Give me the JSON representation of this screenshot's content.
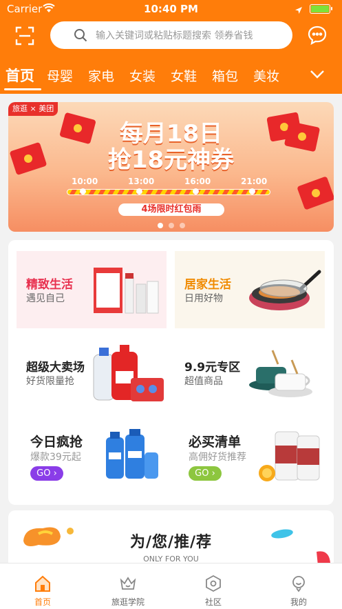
{
  "status_bar": {
    "carrier": "Carrier",
    "time": "10:40 PM"
  },
  "search": {
    "placeholder": "输入关键词或粘贴标题搜索 领券省钱"
  },
  "tabs": [
    {
      "label": "首页",
      "active": true
    },
    {
      "label": "母婴"
    },
    {
      "label": "家电"
    },
    {
      "label": "女装"
    },
    {
      "label": "女鞋"
    },
    {
      "label": "箱包"
    },
    {
      "label": "美妆"
    }
  ],
  "banner": {
    "tag": "旅逛 × 美团",
    "title_line1": "每月18日",
    "title_line2": "抢18元神券",
    "times": [
      "10:00",
      "13:00",
      "16:00",
      "21:00"
    ],
    "pill": "4场限时红包雨",
    "pages": 3,
    "current_page": 1
  },
  "tiles": [
    {
      "title": "精致生活",
      "subtitle": "遇见自己",
      "title_color": "#e8314f",
      "bg": "#fdeef0"
    },
    {
      "title": "居家生活",
      "subtitle": "日用好物",
      "title_color": "#f08a00",
      "bg": "#fbf6ec"
    },
    {
      "title": "超级大卖场",
      "subtitle": "好货限量抢"
    },
    {
      "title": "9.9元专区",
      "subtitle": "超值商品"
    },
    {
      "title": "今日疯抢",
      "subtitle": "爆款39元起",
      "button": "GO",
      "button_color": "#8a3de8"
    },
    {
      "title": "必买清单",
      "subtitle": "高佣好货推荐",
      "button": "GO",
      "button_color": "#8dc63f"
    }
  ],
  "recommend": {
    "title": "为/您/推/荐",
    "subtitle": "ONLY FOR YOU"
  },
  "tabbar": [
    {
      "label": "首页",
      "icon": "home-icon",
      "active": true
    },
    {
      "label": "旅逛学院",
      "icon": "academy-icon"
    },
    {
      "label": "社区",
      "icon": "community-icon"
    },
    {
      "label": "我的",
      "icon": "profile-icon"
    }
  ],
  "colors": {
    "brand": "#ff7d0a",
    "accent_red": "#e8312b"
  }
}
